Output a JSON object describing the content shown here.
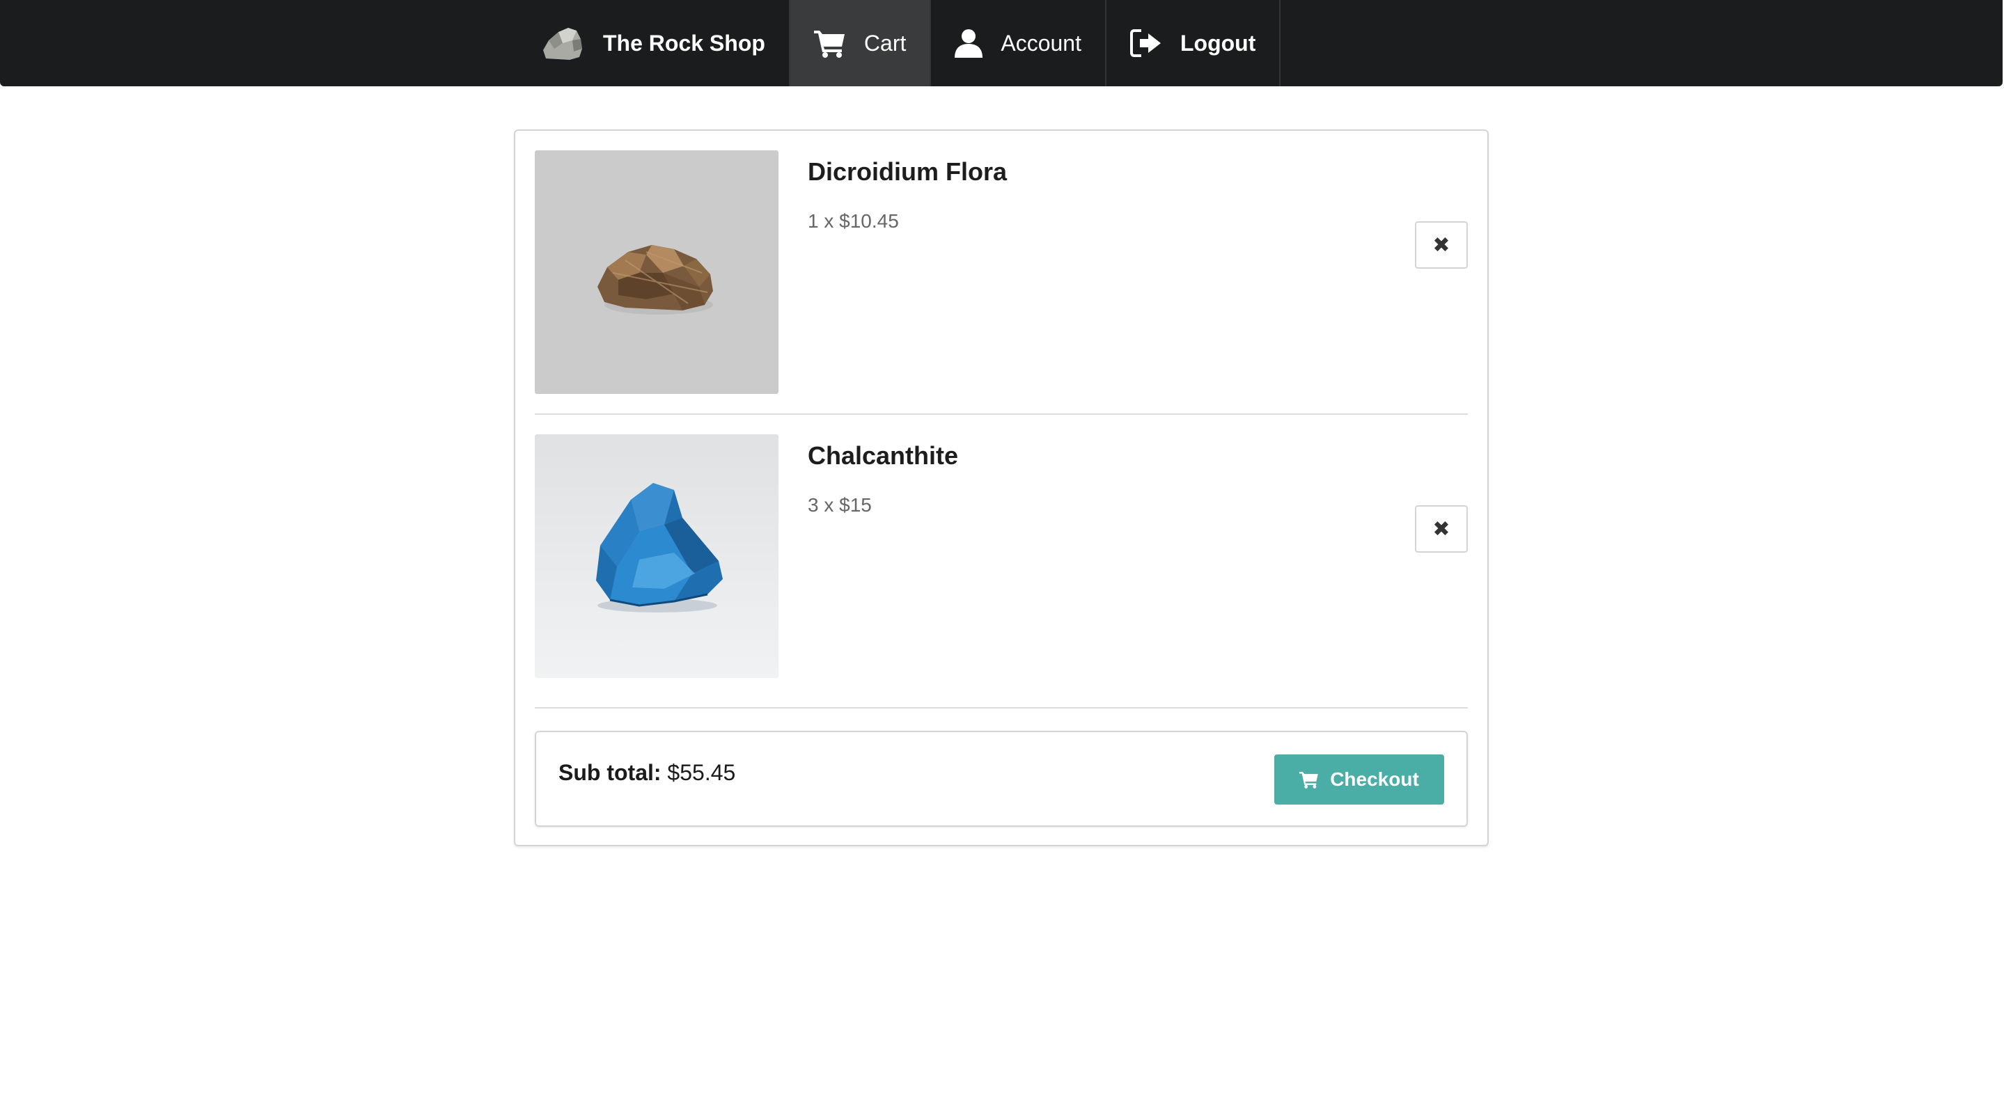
{
  "nav": {
    "brand_label": "The Rock Shop",
    "brand_icon": "rock-icon",
    "items": [
      {
        "label": "Cart",
        "icon": "cart-icon",
        "active": true
      },
      {
        "label": "Account",
        "icon": "user-icon",
        "active": false
      },
      {
        "label": "Logout",
        "icon": "logout-icon",
        "active": false
      }
    ]
  },
  "cart": {
    "items": [
      {
        "name": "Dicroidium Flora",
        "quantity_price": "1 x $10.45",
        "remove_icon": "close-icon"
      },
      {
        "name": "Chalcanthite",
        "quantity_price": "3 x $15",
        "remove_icon": "close-icon"
      }
    ],
    "subtotal_label": "Sub total:",
    "subtotal_value": "$55.45",
    "checkout_label": "Checkout"
  },
  "colors": {
    "navbar": "#1b1c1d",
    "nav_active": "#3a3b3c",
    "checkout_button": "#4aada6"
  }
}
